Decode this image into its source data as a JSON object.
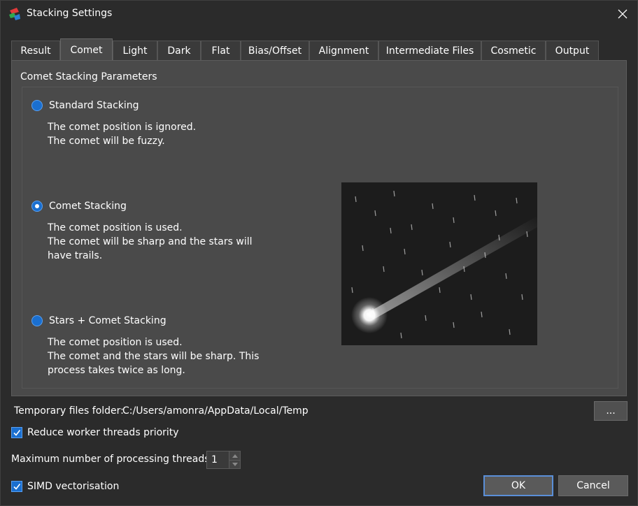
{
  "window": {
    "title": "Stacking Settings"
  },
  "tabs": [
    {
      "label": "Result"
    },
    {
      "label": "Comet",
      "active": true
    },
    {
      "label": "Light"
    },
    {
      "label": "Dark"
    },
    {
      "label": "Flat"
    },
    {
      "label": "Bias/Offset"
    },
    {
      "label": "Alignment"
    },
    {
      "label": "Intermediate Files"
    },
    {
      "label": "Cosmetic"
    },
    {
      "label": "Output"
    }
  ],
  "comet_panel": {
    "group_title": "Comet Stacking Parameters",
    "options": [
      {
        "label": "Standard Stacking",
        "checked": false,
        "desc": [
          "The comet position is ignored.",
          "The comet will be fuzzy."
        ]
      },
      {
        "label": "Comet Stacking",
        "checked": true,
        "desc": [
          "The comet position is used.",
          "The comet will be sharp and the stars will",
          "have trails."
        ]
      },
      {
        "label": "Stars + Comet Stacking",
        "checked": false,
        "desc": [
          "The comet position is used.",
          "The comet and the stars will be sharp. This",
          "process takes twice as long."
        ]
      }
    ]
  },
  "temp_folder": {
    "label": "Temporary files folder:",
    "path": "C:/Users/amonra/AppData/Local/Temp",
    "browse_label": "..."
  },
  "reduce_priority": {
    "label": "Reduce worker threads priority",
    "checked": true
  },
  "max_threads": {
    "label": "Maximum number of processing threads",
    "value": "1"
  },
  "simd": {
    "label": "SIMD vectorisation",
    "checked": true
  },
  "buttons": {
    "ok": "OK",
    "cancel": "Cancel"
  },
  "colors": {
    "accent": "#1a6fd0",
    "background": "#2b2b2b",
    "panel": "#4a4a4a"
  },
  "icons": {
    "app": "app-logo-icon",
    "close": "close-icon",
    "check": "checkmark-icon"
  }
}
